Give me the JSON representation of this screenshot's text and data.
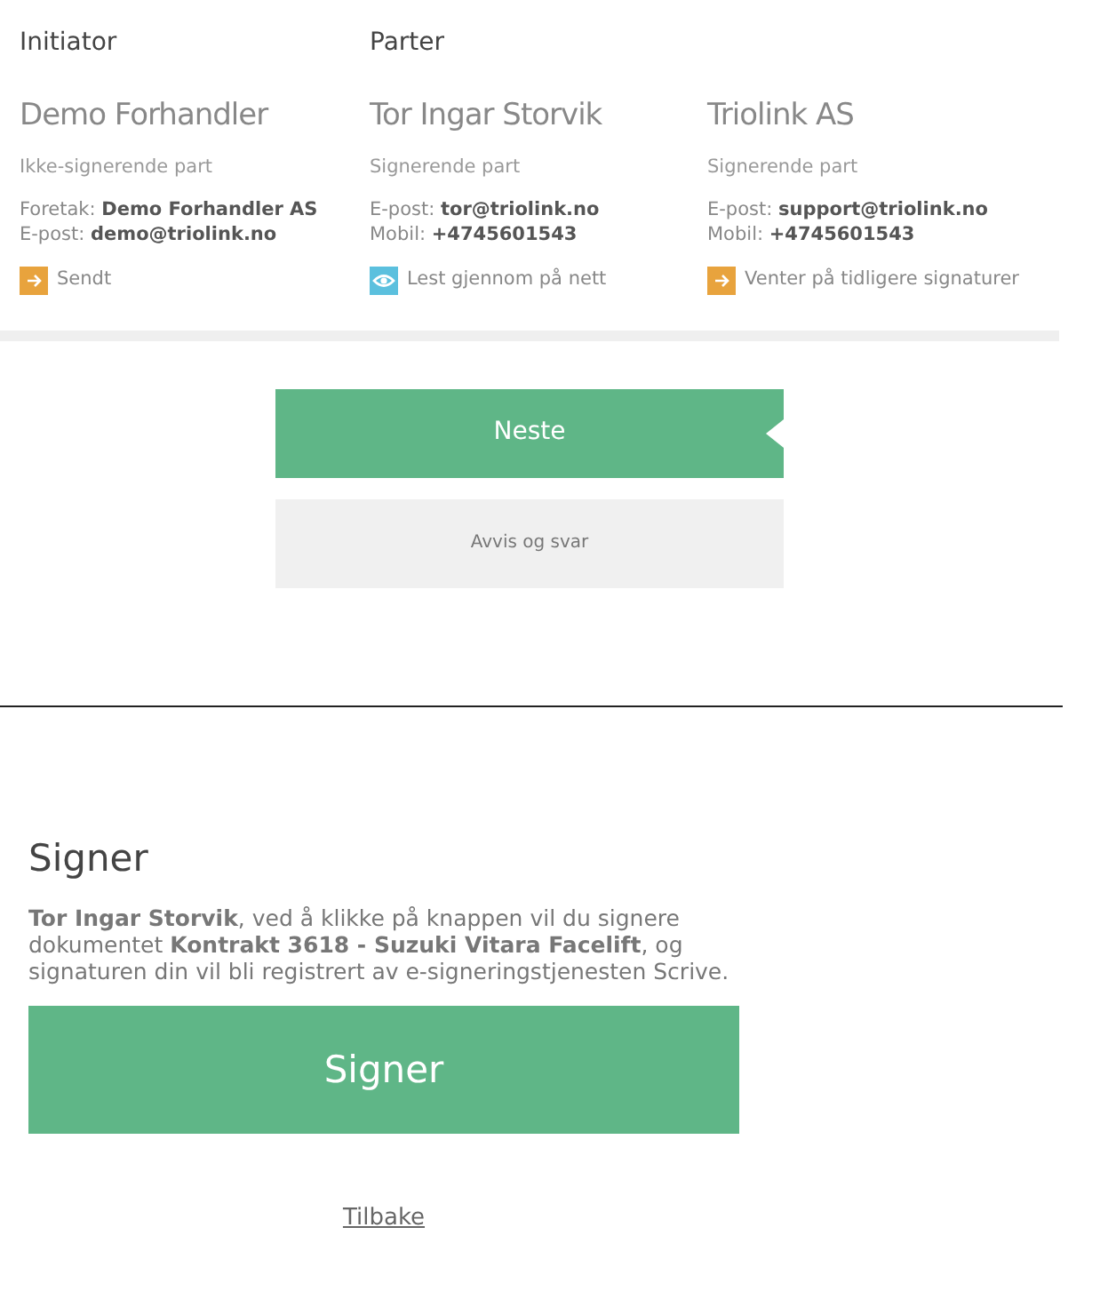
{
  "initiator": {
    "heading": "Initiator",
    "party": {
      "name": "Demo Forhandler",
      "role": "Ikke-signerende part",
      "details": [
        "Foretak: **Demo Forhandler AS**",
        "E-post: **demo@triolink.no**"
      ],
      "status": {
        "kind": "arrow",
        "label": "Sendt"
      }
    }
  },
  "parties": {
    "heading": "Parter",
    "items": [
      {
        "name": "Tor Ingar Storvik",
        "role": "Signerende part",
        "details": [
          "E-post: **tor@triolink.no**",
          "Mobil: **+4745601543**"
        ],
        "status": {
          "kind": "eye",
          "label": "Lest gjennom på nett"
        }
      },
      {
        "name": "Triolink AS",
        "role": "Signerende part",
        "details": [
          "E-post: **support@triolink.no**",
          "Mobil: **+4745601543**"
        ],
        "status": {
          "kind": "arrow",
          "label": "Venter på tidligere signaturer"
        }
      }
    ]
  },
  "actions": {
    "next": "Neste",
    "reject": "Avvis og svar"
  },
  "sign": {
    "title": "Signer",
    "text": "**Tor Ingar Storvik**, ved å klikke på knappen vil du signere dokumentet **Kontrakt 3618 - Suzuki Vitara Facelift**, og signaturen din vil bli registrert av e-signeringstjenesten Scrive.",
    "button": "Signer",
    "back": "Tilbake"
  }
}
